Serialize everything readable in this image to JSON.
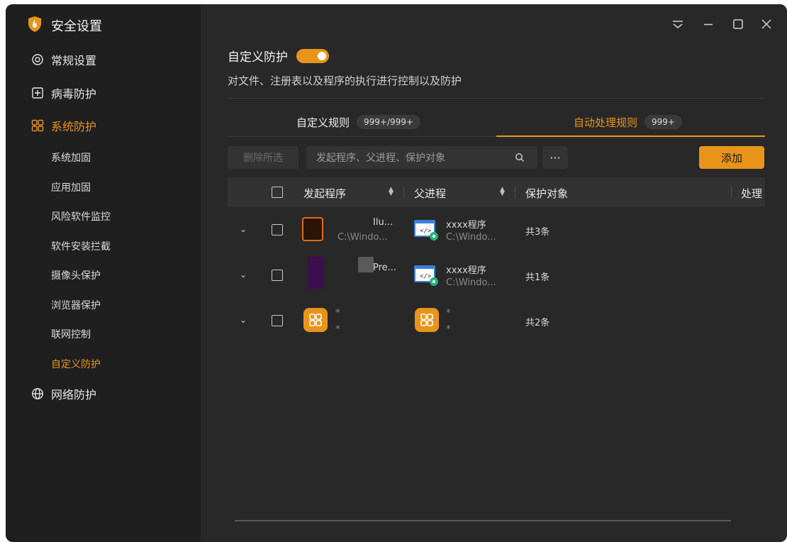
{
  "app": {
    "title": "安全设置",
    "accent": "#e8941a"
  },
  "sidebar": {
    "sections": [
      {
        "label": "常规设置",
        "icon": "gear-icon"
      },
      {
        "label": "病毒防护",
        "icon": "plus-box-icon"
      },
      {
        "label": "系统防护",
        "icon": "grid-icon",
        "active": true
      },
      {
        "label": "网络防护",
        "icon": "globe-icon"
      }
    ],
    "sub_items": [
      {
        "label": "系统加固"
      },
      {
        "label": "应用加固"
      },
      {
        "label": "风险软件监控"
      },
      {
        "label": "软件安装拦截"
      },
      {
        "label": "摄像头保护"
      },
      {
        "label": "浏览器保护"
      },
      {
        "label": "联网控制"
      },
      {
        "label": "自定义防护",
        "active": true
      }
    ]
  },
  "main": {
    "title": "自定义防护",
    "toggle_on": true,
    "description": "对文件、注册表以及程序的执行进行控制以及防护",
    "tabs": [
      {
        "label": "自定义规则",
        "badge": "999+/999+"
      },
      {
        "label": "自动处理规则",
        "badge": "999+",
        "active": true
      }
    ],
    "toolbar": {
      "delete_label": "删除所选",
      "search_placeholder": "发起程序、父进程、保护对象",
      "more_label": "···",
      "add_label": "添加"
    },
    "table": {
      "headers": [
        "发起程序",
        "父进程",
        "保护对象",
        "处理"
      ],
      "rows": [
        {
          "initiator_name": "Ilu...",
          "initiator_path": "C:\\Windo...",
          "parent_name": "xxxx程序",
          "parent_path": "C:\\Windo...",
          "target": "共3条"
        },
        {
          "initiator_name": "Pre...",
          "initiator_path": "",
          "parent_name": "xxxx程序",
          "parent_path": "C:\\Windo...",
          "target": "共1条"
        },
        {
          "initiator_name": "*",
          "initiator_path": "*",
          "parent_name": "*",
          "parent_path": "*",
          "target": "共2条"
        }
      ]
    }
  }
}
